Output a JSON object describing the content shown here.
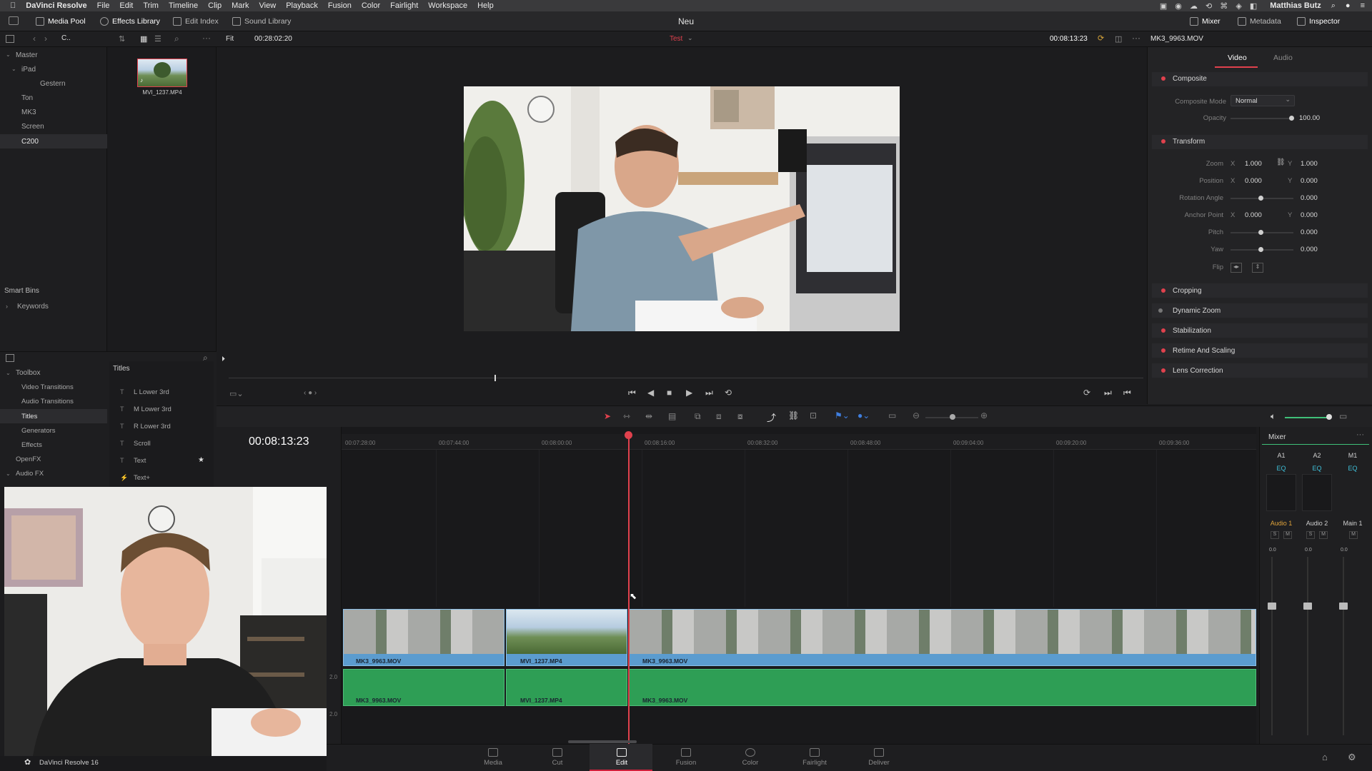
{
  "menubar": {
    "app": "DaVinci Resolve",
    "items": [
      "File",
      "Edit",
      "Trim",
      "Timeline",
      "Clip",
      "Mark",
      "View",
      "Playback",
      "Fusion",
      "Color",
      "Fairlight",
      "Workspace",
      "Help"
    ],
    "user": "Matthias Butz"
  },
  "toolbar": {
    "media_pool": "Media Pool",
    "effects_library": "Effects Library",
    "edit_index": "Edit Index",
    "sound_library": "Sound Library",
    "project_title": "Neu",
    "mixer": "Mixer",
    "metadata": "Metadata",
    "inspector": "Inspector"
  },
  "viewer_bar": {
    "fit": "Fit",
    "source_timecode": "00:28:02:20",
    "timeline_name": "Test",
    "record_timecode": "00:08:13:23",
    "clip_name": "MK3_9963.MOV"
  },
  "bins": {
    "master": "Master",
    "items": [
      "iPad",
      "Gestern",
      "Ton",
      "MK3",
      "Screen",
      "C200"
    ],
    "smart_bins": "Smart Bins",
    "keywords": "Keywords"
  },
  "media_pool_clip": "MVI_1237.MP4",
  "effects": {
    "toolbox": "Toolbox",
    "tree": [
      "Video Transitions",
      "Audio Transitions",
      "Titles",
      "Generators",
      "Effects",
      "OpenFX",
      "Audio FX"
    ],
    "titles_header": "Titles",
    "titles": [
      "L Lower 3rd",
      "M Lower 3rd",
      "R Lower 3rd",
      "Scroll",
      "Text",
      "Text+"
    ]
  },
  "timeline": {
    "timecode": "00:08:13:23",
    "ruler": [
      "00:07:28:00",
      "00:07:44:00",
      "00:08:00:00",
      "00:08:16:00",
      "00:08:32:00",
      "00:08:48:00",
      "00:09:04:00",
      "00:09:20:00",
      "00:09:36:00"
    ],
    "video_clips": [
      "MK3_9963.MOV",
      "MVI_1237.MP4",
      "MK3_9963.MOV"
    ],
    "audio_clips": [
      "MK3_9963.MOV",
      "MVI_1237.MP4",
      "MK3_9963.MOV"
    ],
    "track_levels": [
      "2.0",
      "2.0"
    ]
  },
  "inspector": {
    "tabs": [
      "Video",
      "Audio"
    ],
    "composite": "Composite",
    "composite_mode_label": "Composite Mode",
    "composite_mode_value": "Normal",
    "opacity_label": "Opacity",
    "opacity_value": "100.00",
    "transform": "Transform",
    "zoom_label": "Zoom",
    "zoom_x": "1.000",
    "zoom_y": "1.000",
    "position_label": "Position",
    "position_x": "0.000",
    "position_y": "0.000",
    "rotation_label": "Rotation Angle",
    "rotation_value": "0.000",
    "anchor_label": "Anchor Point",
    "anchor_x": "0.000",
    "anchor_y": "0.000",
    "pitch_label": "Pitch",
    "pitch_value": "0.000",
    "yaw_label": "Yaw",
    "yaw_value": "0.000",
    "flip_label": "Flip",
    "x": "X",
    "y": "Y",
    "sections": [
      "Cropping",
      "Dynamic Zoom",
      "Stabilization",
      "Retime And Scaling",
      "Lens Correction"
    ]
  },
  "mixer": {
    "title": "Mixer",
    "channels": [
      "A1",
      "A2",
      "M1"
    ],
    "eq": "EQ",
    "tracks": [
      "Audio 1",
      "Audio 2",
      "Main 1"
    ],
    "level": "0.0"
  },
  "pages": [
    "Media",
    "Cut",
    "Edit",
    "Fusion",
    "Color",
    "Fairlight",
    "Deliver"
  ],
  "active_page": "Edit",
  "footer": "DaVinci Resolve 16",
  "colors": {
    "accent": "#e0414d",
    "video_clip": "#5b9ccf",
    "audio_clip": "#2e9e55",
    "active_page": "#d0203a"
  }
}
